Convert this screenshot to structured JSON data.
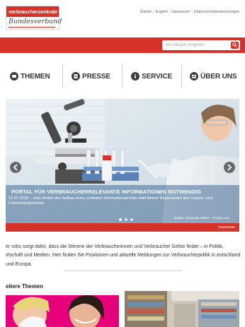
{
  "header": {
    "logo_top": "verbraucherzentrale",
    "logo_bottom": "Bundesverband",
    "meta_links": [
      "Statuts",
      "English",
      "Impressum",
      "Datenschutzbestimmungen"
    ]
  },
  "search": {
    "placeholder": "Suchbegriff eingeben"
  },
  "nav": {
    "items": [
      {
        "label": "THEMEN",
        "icon": "themen-icon"
      },
      {
        "label": "PRESSE",
        "icon": "presse-icon"
      },
      {
        "label": "SERVICE",
        "icon": "info-icon"
      },
      {
        "label": "ÜBER UNS",
        "icon": "ueber-uns-icon"
      }
    ]
  },
  "slider": {
    "title": "PORTAL FÜR VERBRAUCHERRELEVANTE INFORMATIONEN NOTWENDIG",
    "text": "10.07.2018 – vzbv fordert den Aufbau eines zentralen Informationsportals statt kleiner Reparaturen des Lebens- und Futtermittelgesetzes",
    "source": "Quelle: Alexander Raths – Fotolia.com",
    "pause": "Pause/Start",
    "dots": 3,
    "active_dot": 0
  },
  "intro": {
    "text": "er vzbv sorgt dafür, dass die Stimme der Verbraucherinnen und Verbraucher Gehör findet – in Politik, irtschaft und Medien. Hier finden Sie Positionen und aktuelle Meldungen zur Verbraucherpolitik in eutschland und Europa."
  },
  "more": {
    "title": "eitere Themen"
  },
  "colors": {
    "brand_red": "#d6322a",
    "nav_icon": "#3c3c3c"
  }
}
